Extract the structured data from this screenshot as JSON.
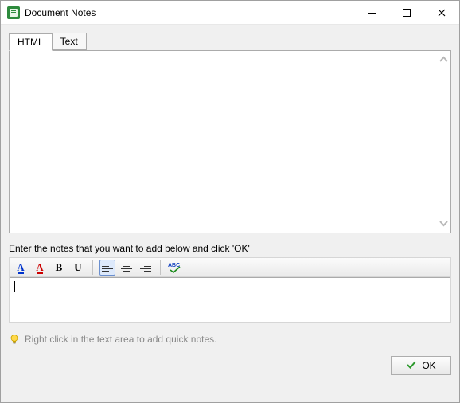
{
  "window": {
    "title": "Document Notes"
  },
  "tabs": [
    {
      "label": "HTML",
      "active": true
    },
    {
      "label": "Text",
      "active": false
    }
  ],
  "prompt": "Enter the notes that you want to add below and click 'OK'",
  "toolbar": {
    "highlight_color": "#0033cc",
    "font_color": "#cc0000",
    "bold_glyph": "B",
    "underline_glyph": "U",
    "spellcheck_label": "ABC"
  },
  "editor": {
    "value": ""
  },
  "hint": "Right click in the text area to add quick notes.",
  "buttons": {
    "ok": "OK"
  },
  "icons": {
    "app_name": "document-notes-app-icon"
  }
}
